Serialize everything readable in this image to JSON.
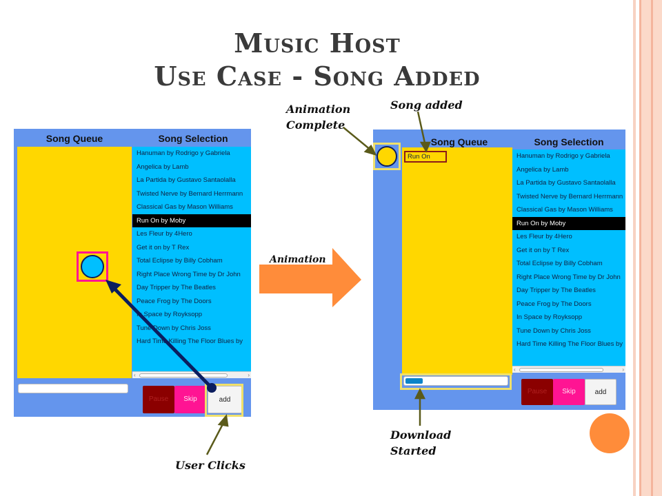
{
  "slide": {
    "title_line1": "Music Host",
    "title_line2": "Use Case - Song Added"
  },
  "annotations": {
    "animation_complete": "Animation Complete",
    "song_added": "Song added",
    "animation": "Animation",
    "user_clicks": "User Clicks",
    "download_started": "Download Started"
  },
  "app": {
    "queue_header": "Song Queue",
    "selection_header": "Song Selection",
    "songs": [
      "Hanuman by Rodrigo y Gabriela",
      "Angelica by Lamb",
      "La Partida by Gustavo Santaolalla",
      "Twisted Nerve by Bernard Herrmann",
      "Classical Gas by Mason Williams",
      "Run On by Moby",
      "Les Fleur by 4Hero",
      "Get it on by T Rex",
      "Total Eclipse by Billy Cobham",
      "Right Place Wrong Time by Dr John",
      "Day Tripper by The Beatles",
      "Peace Frog by The Doors",
      "In Space by Royksopp",
      "Tune Down by Chris Joss",
      "Hard Time Killing The Floor Blues by"
    ],
    "selected_song": "Run On by Moby",
    "pause_label": "Pause",
    "skip_label": "Skip",
    "add_label": "add",
    "queued_song": "Run On",
    "download_progress": 0.17
  },
  "colors": {
    "app_bg": "#6495ed",
    "queue_bg": "#ffd700",
    "selection_bg": "#00bfff",
    "accent_orange": "#ff8c3a",
    "highlight_magenta": "#ff1493",
    "highlight_yellow": "#f0e06a",
    "arrow_navy": "#0b1d5e"
  }
}
